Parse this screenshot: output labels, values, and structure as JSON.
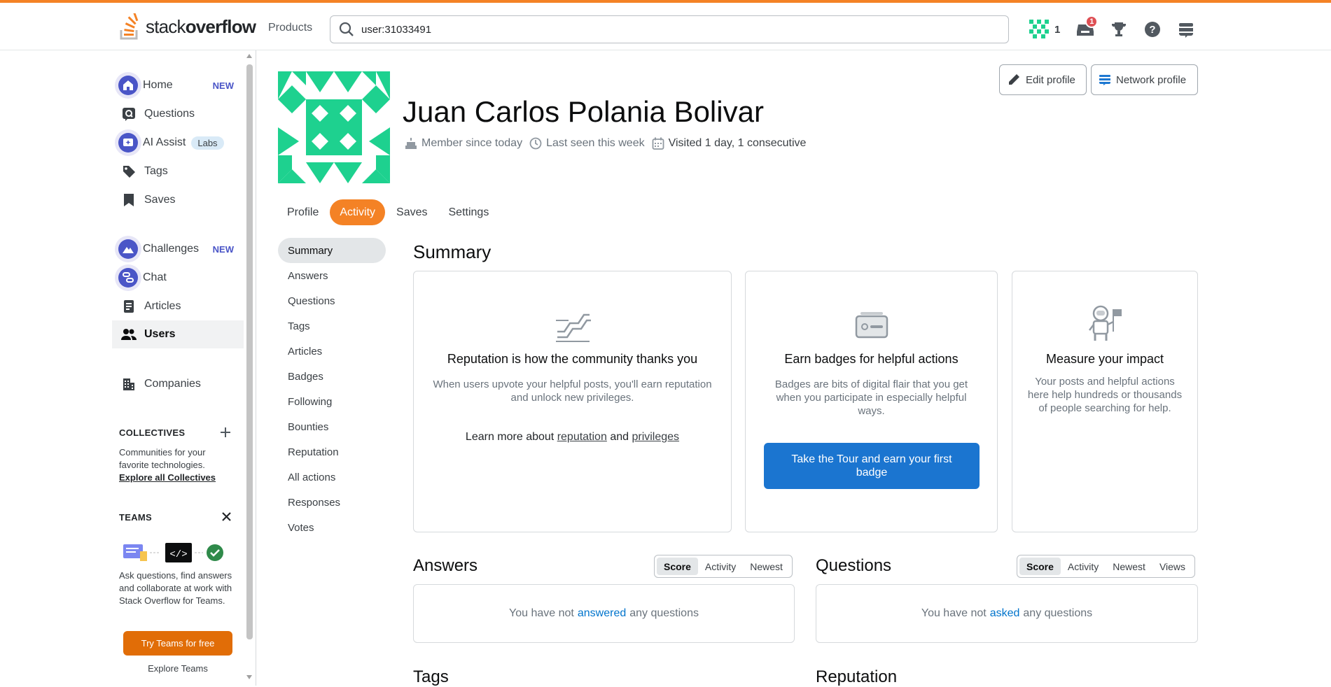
{
  "header": {
    "logo_text_light": "stack",
    "logo_text_bold": "overflow",
    "products_label": "Products",
    "search_value": "user:31033491",
    "reputation": "1",
    "inbox_count": "1",
    "accent_color": "#f48225"
  },
  "sidebar": {
    "items": [
      {
        "label": "Home",
        "badge": "NEW",
        "icon": "home-icon"
      },
      {
        "label": "Questions",
        "icon": "questions-icon"
      },
      {
        "label": "AI Assist",
        "badge": "Labs",
        "icon": "ai-assist-icon"
      },
      {
        "label": "Tags",
        "icon": "tag-icon"
      },
      {
        "label": "Saves",
        "icon": "bookmark-icon"
      },
      {
        "label": "Challenges",
        "badge": "NEW",
        "icon": "challenges-icon"
      },
      {
        "label": "Chat",
        "icon": "chat-icon"
      },
      {
        "label": "Articles",
        "icon": "articles-icon"
      },
      {
        "label": "Users",
        "icon": "users-icon",
        "active": true
      },
      {
        "label": "Companies",
        "icon": "companies-icon"
      }
    ],
    "collectives": {
      "title": "COLLECTIVES",
      "text": "Communities for your favorite technologies.",
      "link": "Explore all Collectives"
    },
    "teams": {
      "title": "TEAMS",
      "text": "Ask questions, find answers and collaborate at work with Stack Overflow for Teams.",
      "button": "Try Teams for free",
      "link": "Explore Teams"
    }
  },
  "profile": {
    "name": "Juan Carlos Polania Bolivar",
    "member_since": "Member since today",
    "last_seen": "Last seen this week",
    "visited": "Visited 1 day, 1 consecutive",
    "edit_button": "Edit profile",
    "network_button": "Network profile",
    "avatar_color": "#1ed18f"
  },
  "tabs": [
    "Profile",
    "Activity",
    "Saves",
    "Settings"
  ],
  "active_tab": "Activity",
  "subnav": [
    "Summary",
    "Answers",
    "Questions",
    "Tags",
    "Articles",
    "Badges",
    "Following",
    "Bounties",
    "Reputation",
    "All actions",
    "Responses",
    "Votes"
  ],
  "summary": {
    "title": "Summary",
    "cards": [
      {
        "title": "Reputation is how the community thanks you",
        "desc": "When users upvote your helpful posts, you'll earn reputation and unlock new privileges.",
        "learn_prefix": "Learn more about",
        "learn_link1": "reputation",
        "learn_and": "and",
        "learn_link2": "privileges"
      },
      {
        "title": "Earn badges for helpful actions",
        "desc": "Badges are bits of digital flair that you get when you participate in especially helpful ways.",
        "button": "Take the Tour and earn your first badge"
      },
      {
        "title": "Measure your impact",
        "desc": "Your posts and helpful actions here help hundreds or thousands of people searching for help."
      }
    ]
  },
  "answers": {
    "title": "Answers",
    "filters": [
      "Score",
      "Activity",
      "Newest"
    ],
    "empty_prefix": "You have not",
    "empty_link": "answered",
    "empty_suffix": "any questions"
  },
  "questions": {
    "title": "Questions",
    "filters": [
      "Score",
      "Activity",
      "Newest",
      "Views"
    ],
    "empty_prefix": "You have not",
    "empty_link": "asked",
    "empty_suffix": "any questions"
  },
  "tags_title": "Tags",
  "reputation_title": "Reputation"
}
